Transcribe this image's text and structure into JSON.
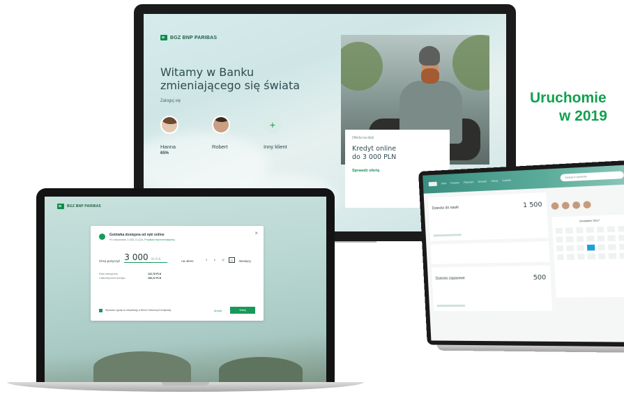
{
  "headline": {
    "line1": "Uruchomie",
    "line2": "w 2019",
    "color": "#12a050"
  },
  "brand": {
    "name": "BGZ BNP PARIBAS",
    "accent": "#0d8c4e"
  },
  "imac": {
    "welcome_line1": "Witamy w Banku",
    "welcome_line2": "zmieniającego się świata",
    "login_hint": "Zaloguj się",
    "users": [
      {
        "name": "Hanna",
        "extra": "65%"
      },
      {
        "name": "Robert",
        "extra": ""
      },
      {
        "name": "Inny klient",
        "extra": ""
      }
    ],
    "add_symbol": "+",
    "offer": {
      "tag": "Oferta na dziś",
      "title_line1": "Kredyt online",
      "title_line2": "do 3 000 PLN",
      "link": "Sprawdź ofertę"
    }
  },
  "laptop_dialog": {
    "title": "Gotówka dostępna od ręki online",
    "subtitle": "Po otrzymaniu 2 (00) 11 (22), ",
    "subtitle_link": "Przykład reprezentatywny",
    "amount_label": "Chcę pożyczyć",
    "amount": "3 000",
    "amount_unit": "00 PLN",
    "period_label": "na okres",
    "period_options": [
      "3",
      "6",
      "12",
      "24"
    ],
    "period_selected": "24",
    "period_unit": "miesięcy",
    "rate_label": "Rata miesięczna",
    "rate_value": "132,78 PLN",
    "total_label": "Całkowity koszt kredytu",
    "total_value": "186,12 PLN",
    "consent": "Wyrażam zgodę na weryfikację w Biurze Informacji Kredytowej",
    "back": "Anuluj",
    "submit": "Dalej",
    "close": "×"
  },
  "tablet": {
    "nav": [
      "Start",
      "Finanse",
      "Płatności",
      "Wnioski",
      "Oferty",
      "Kontakt"
    ],
    "search_placeholder": "Szukaj w systemie",
    "accounts": [
      {
        "name": "Dziecko do nauki",
        "balance": "1 500"
      },
      {
        "name": "Dziecko zapasowe",
        "balance": "500"
      }
    ],
    "calendar_title": "Grudzień 2017"
  }
}
